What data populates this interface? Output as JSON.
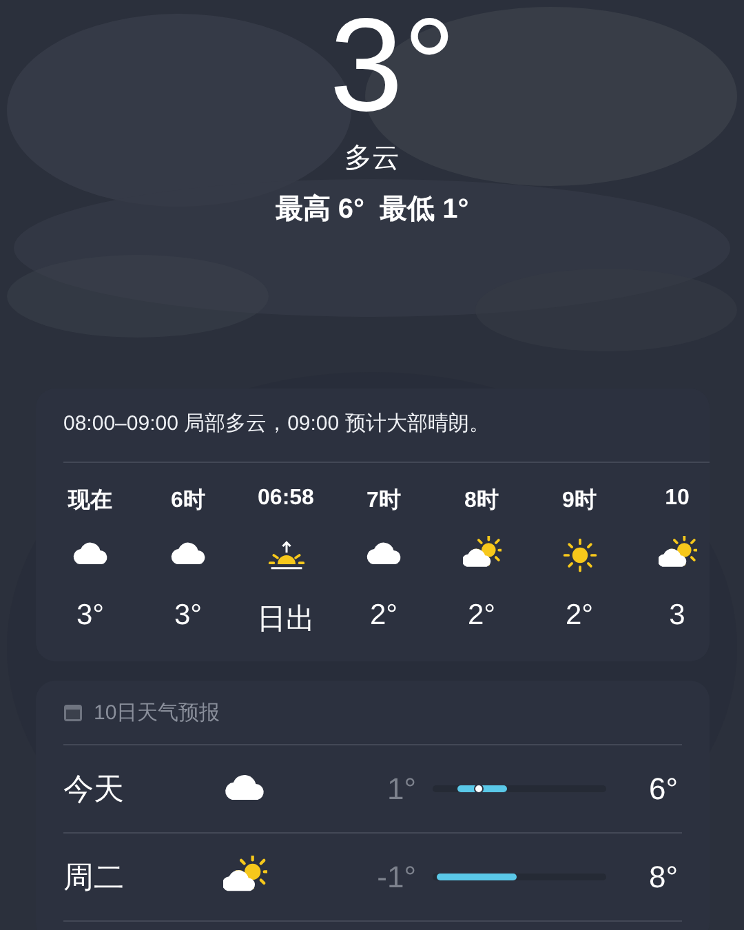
{
  "current": {
    "temperature": "3°",
    "condition": "多云",
    "high_low": "最高 6°  最低 1°"
  },
  "hourly": {
    "summary": "08:00–09:00 局部多云，09:00 预计大部晴朗。",
    "hours": [
      {
        "time": "现在",
        "kind": "cloudy",
        "temp": "3°"
      },
      {
        "time": "6时",
        "kind": "cloudy",
        "temp": "3°"
      },
      {
        "time": "06:58",
        "kind": "sunrise",
        "temp": "日出"
      },
      {
        "time": "7时",
        "kind": "cloudy",
        "temp": "2°"
      },
      {
        "time": "8时",
        "kind": "partly_sunny",
        "temp": "2°"
      },
      {
        "time": "9时",
        "kind": "sunny",
        "temp": "2°"
      },
      {
        "time": "10",
        "kind": "partly_sunny",
        "temp": "3"
      }
    ]
  },
  "daily": {
    "title": "10日天气预报",
    "days": [
      {
        "day": "今天",
        "kind": "cloudy",
        "low": "1°",
        "high": "6°",
        "level": 0.3,
        "now_marker": true
      },
      {
        "day": "周二",
        "kind": "partly_sunny",
        "low": "-1°",
        "high": "8°",
        "level": 0.48,
        "now_marker": false
      }
    ]
  }
}
